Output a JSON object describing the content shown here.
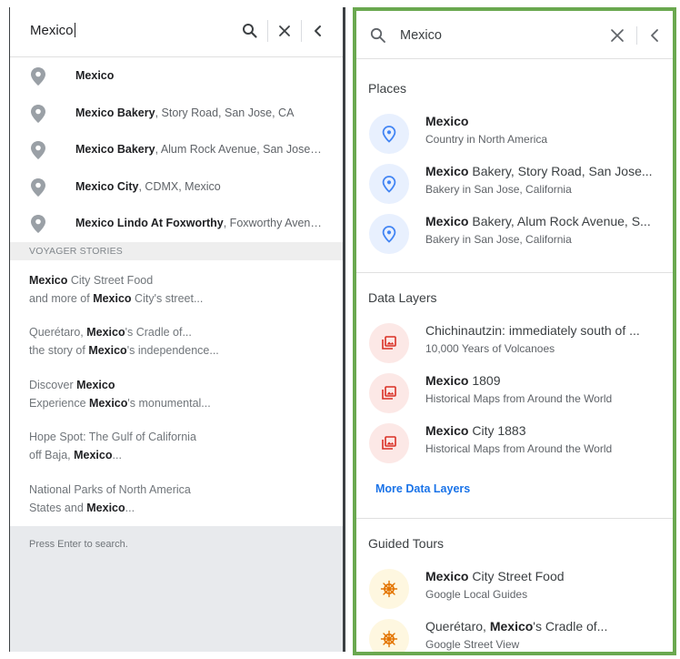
{
  "left": {
    "search": {
      "query": "Mexico"
    },
    "results": [
      {
        "bold": "Mexico",
        "rest": ""
      },
      {
        "bold": "Mexico Bakery",
        "rest": ", Story Road, San Jose, CA"
      },
      {
        "bold": "Mexico Bakery",
        "rest": ", Alum Rock Avenue, San Jose, ..."
      },
      {
        "bold": "Mexico City",
        "rest": ", CDMX, Mexico"
      },
      {
        "bold": "Mexico Lindo At Foxworthy",
        "rest": ", Foxworthy Avenu..."
      }
    ],
    "voyager_header": "VOYAGER STORIES",
    "stories": [
      {
        "l1_pre": "",
        "l1_bold": "Mexico",
        "l1_post": " City Street Food",
        "l2_pre": "and more of ",
        "l2_bold": "Mexico",
        "l2_post": " City's street..."
      },
      {
        "l1_pre": "Querétaro, ",
        "l1_bold": "Mexico",
        "l1_post": "'s Cradle of...",
        "l2_pre": "the story of ",
        "l2_bold": "Mexico",
        "l2_post": "'s independence..."
      },
      {
        "l1_pre": "Discover ",
        "l1_bold": "Mexico",
        "l1_post": "",
        "l2_pre": "Experience ",
        "l2_bold": "Mexico",
        "l2_post": "'s monumental..."
      },
      {
        "l1_pre": "Hope Spot: The Gulf of California",
        "l1_bold": "",
        "l1_post": "",
        "l2_pre": "off Baja, ",
        "l2_bold": "Mexico",
        "l2_post": "..."
      },
      {
        "l1_pre": "National Parks of North America",
        "l1_bold": "",
        "l1_post": "",
        "l2_pre": "States and ",
        "l2_bold": "Mexico",
        "l2_post": "..."
      }
    ],
    "footer": "Press Enter to search."
  },
  "right": {
    "search": {
      "query": "Mexico"
    },
    "places_title": "Places",
    "places": [
      {
        "bold": "Mexico",
        "rest": "",
        "sub": "Country in North America"
      },
      {
        "bold": "Mexico",
        "rest": " Bakery, Story Road, San Jose...",
        "sub": "Bakery in San Jose, California"
      },
      {
        "bold": "Mexico",
        "rest": " Bakery, Alum Rock Avenue, S...",
        "sub": "Bakery in San Jose, California"
      }
    ],
    "data_layers_title": "Data Layers",
    "data_layers": [
      {
        "pre": "Chichinautzin: immediately south of ...",
        "bold": "",
        "rest": "",
        "sub": "10,000 Years of Volcanoes"
      },
      {
        "pre": "",
        "bold": "Mexico",
        "rest": " 1809",
        "sub": "Historical Maps from Around the World"
      },
      {
        "pre": "",
        "bold": "Mexico",
        "rest": " City 1883",
        "sub": "Historical Maps from Around the World"
      }
    ],
    "more_data_layers": "More Data Layers",
    "guided_tours_title": "Guided Tours",
    "guided_tours": [
      {
        "pre": "",
        "bold": "Mexico",
        "rest": " City Street Food",
        "sub": "Google Local Guides"
      },
      {
        "pre": "Querétaro, ",
        "bold": "Mexico",
        "rest": "'s Cradle of...",
        "sub": "Google Street View"
      }
    ]
  },
  "colors": {
    "panel_border": "#6aa84f",
    "place_icon": "#4285f4",
    "layer_icon": "#d93025",
    "tour_icon": "#e37400",
    "link": "#1a73e8"
  },
  "icons": [
    "search-icon",
    "close-icon",
    "chevron-left-icon",
    "map-pin-icon",
    "place-icon",
    "image-layer-icon",
    "ship-wheel-icon"
  ]
}
